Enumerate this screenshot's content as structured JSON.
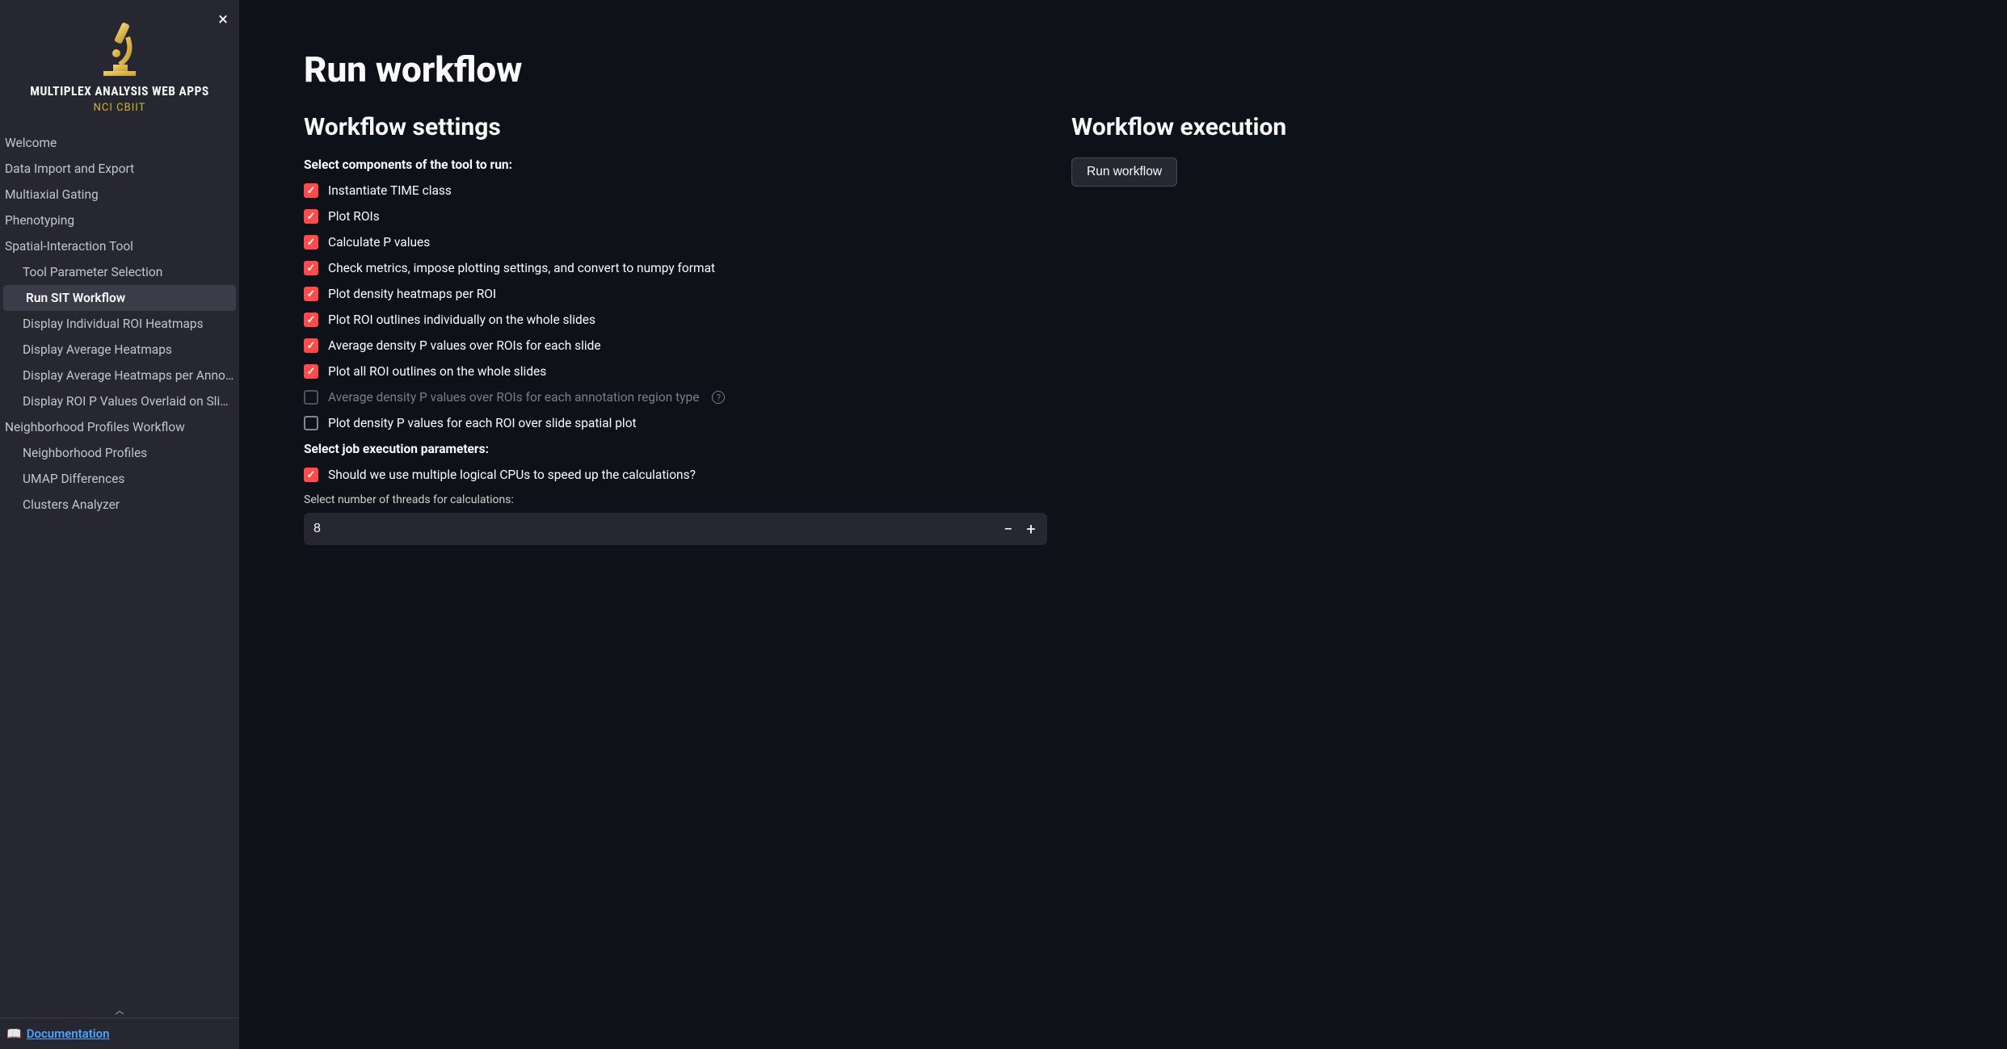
{
  "brand": {
    "title": "MULTIPLEX ANALYSIS WEB APPS",
    "subtitle": "NCI CBIIT"
  },
  "sidebar": {
    "items": [
      {
        "label": "Welcome",
        "sub": false,
        "active": false
      },
      {
        "label": "Data Import and Export",
        "sub": false,
        "active": false
      },
      {
        "label": "Multiaxial Gating",
        "sub": false,
        "active": false
      },
      {
        "label": "Phenotyping",
        "sub": false,
        "active": false
      },
      {
        "label": "Spatial-Interaction Tool",
        "sub": false,
        "active": false
      },
      {
        "label": "Tool Parameter Selection",
        "sub": true,
        "active": false
      },
      {
        "label": "Run SIT Workflow",
        "sub": true,
        "active": true
      },
      {
        "label": "Display Individual ROI Heatmaps",
        "sub": true,
        "active": false
      },
      {
        "label": "Display Average Heatmaps",
        "sub": true,
        "active": false
      },
      {
        "label": "Display Average Heatmaps per Annota…",
        "sub": true,
        "active": false
      },
      {
        "label": "Display ROI P Values Overlaid on Slides",
        "sub": true,
        "active": false
      },
      {
        "label": "Neighborhood Profiles Workflow",
        "sub": false,
        "active": false
      },
      {
        "label": "Neighborhood Profiles",
        "sub": true,
        "active": false
      },
      {
        "label": "UMAP Differences",
        "sub": true,
        "active": false
      },
      {
        "label": "Clusters Analyzer",
        "sub": true,
        "active": false
      }
    ]
  },
  "footer": {
    "doc_icon": "📖",
    "doc_label": "Documentation"
  },
  "page": {
    "title": "Run workflow",
    "settings_heading": "Workflow settings",
    "exec_heading": "Workflow execution",
    "components_label": "Select components of the tool to run:",
    "params_label": "Select job execution parameters:",
    "threads_label": "Select number of threads for calculations:",
    "run_button": "Run workflow"
  },
  "checkboxes": [
    {
      "label": "Instantiate TIME class",
      "checked": true,
      "disabled": false,
      "help": false
    },
    {
      "label": "Plot ROIs",
      "checked": true,
      "disabled": false,
      "help": false
    },
    {
      "label": "Calculate P values",
      "checked": true,
      "disabled": false,
      "help": false
    },
    {
      "label": "Check metrics, impose plotting settings, and convert to numpy format",
      "checked": true,
      "disabled": false,
      "help": false
    },
    {
      "label": "Plot density heatmaps per ROI",
      "checked": true,
      "disabled": false,
      "help": false
    },
    {
      "label": "Plot ROI outlines individually on the whole slides",
      "checked": true,
      "disabled": false,
      "help": false
    },
    {
      "label": "Average density P values over ROIs for each slide",
      "checked": true,
      "disabled": false,
      "help": false
    },
    {
      "label": "Plot all ROI outlines on the whole slides",
      "checked": true,
      "disabled": false,
      "help": false
    },
    {
      "label": "Average density P values over ROIs for each annotation region type",
      "checked": false,
      "disabled": true,
      "help": true
    },
    {
      "label": "Plot density P values for each ROI over slide spatial plot",
      "checked": false,
      "disabled": false,
      "help": false
    }
  ],
  "cpu_checkbox": {
    "label": "Should we use multiple logical CPUs to speed up the calculations?",
    "checked": true
  },
  "threads_value": "8"
}
